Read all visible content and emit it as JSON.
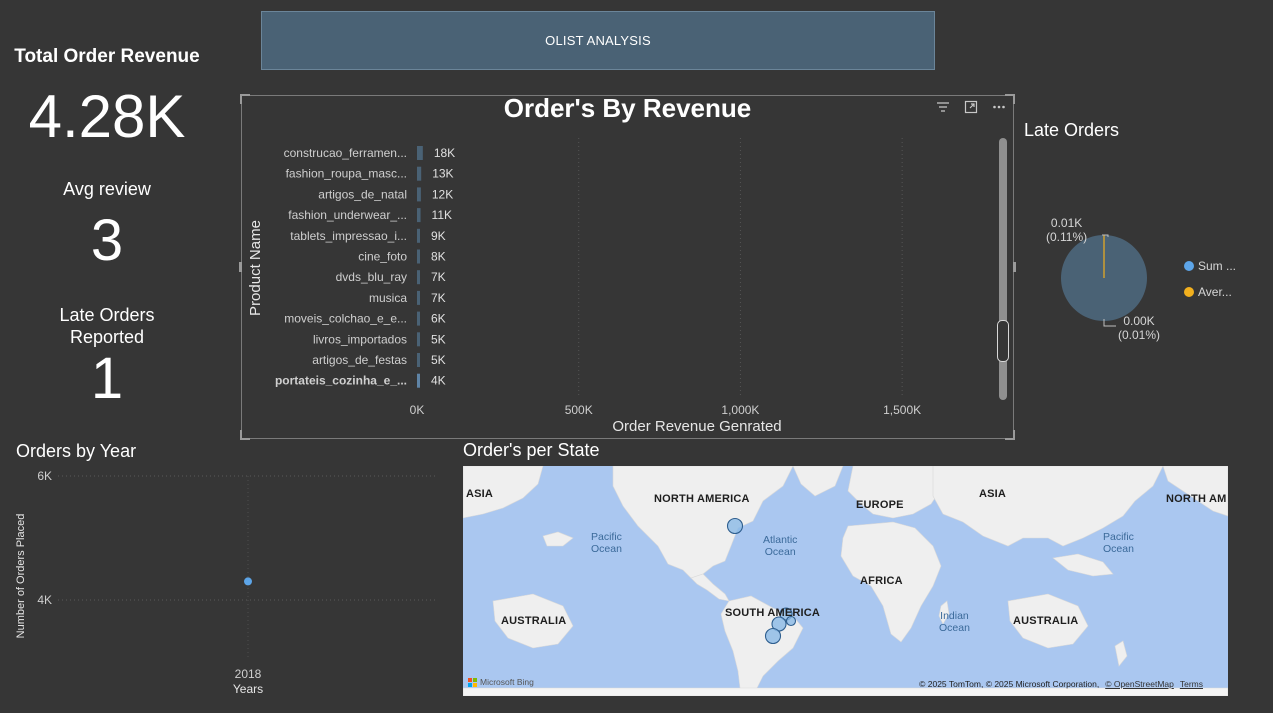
{
  "banner": {
    "title": "OLIST ANALYSIS"
  },
  "kpis": {
    "revenue_label": "Total Order Revenue",
    "revenue_value": "4.28K",
    "review_label": "Avg review",
    "review_value": "3",
    "late_label_line1": "Late Orders",
    "late_label_line2": "Reported",
    "late_value": "1"
  },
  "bar_chart": {
    "title": "Order's By Revenue",
    "icons": [
      "filter-icon",
      "focus-mode-icon",
      "more-options-icon"
    ]
  },
  "pie": {
    "title": "Late Orders",
    "label_top": "0.01K",
    "label_top_pct": "(0.11%)",
    "label_bottom": "0.00K",
    "label_bottom_pct": "(0.01%)",
    "legend": [
      {
        "label": "Sum ...",
        "color": "#5da5e8"
      },
      {
        "label": "Aver...",
        "color": "#f2b01e"
      }
    ]
  },
  "year_chart": {
    "title": "Orders by Year"
  },
  "map": {
    "title": "Order's per State",
    "labels": {
      "asia_left": "ASIA",
      "north_america": "NORTH AMERICA",
      "europe": "EUROPE",
      "asia_right": "ASIA",
      "north_america_right": "NORTH AM",
      "africa": "AFRICA",
      "south_america": "SOUTH AMERICA",
      "australia_left": "AUSTRALIA",
      "australia_right": "AUSTRALIA",
      "pacific_left": "Pacific\nOcean",
      "atlantic": "Atlantic\nOcean",
      "pacific_right": "Pacific\nOcean",
      "indian": "Indian\nOcean"
    },
    "credit": "© 2025 TomTom, © 2025 Microsoft Corporation,",
    "credit_osm": "© OpenStreetMap",
    "credit_terms": "Terms",
    "bing": "Microsoft Bing"
  },
  "chart_data": [
    {
      "type": "bar",
      "orientation": "horizontal",
      "title": "Order's By Revenue",
      "xlabel": "Order Revenue Genrated",
      "ylabel": "Product Name",
      "categories": [
        "construcao_ferramen...",
        "fashion_roupa_masc...",
        "artigos_de_natal",
        "fashion_underwear_...",
        "tablets_impressao_i...",
        "cine_foto",
        "dvds_blu_ray",
        "musica",
        "moveis_colchao_e_e...",
        "livros_importados",
        "artigos_de_festas",
        "portateis_cozinha_e_..."
      ],
      "values": [
        18000,
        13000,
        12000,
        11000,
        9000,
        8000,
        7000,
        7000,
        6000,
        5000,
        5000,
        4000
      ],
      "data_labels": [
        "18K",
        "13K",
        "12K",
        "11K",
        "9K",
        "8K",
        "7K",
        "7K",
        "6K",
        "5K",
        "5K",
        "4K"
      ],
      "xticks": [
        "0K",
        "500K",
        "1,000K",
        "1,500K"
      ],
      "xlim": [
        0,
        1750000
      ],
      "grid": true,
      "color": "#4a6275"
    },
    {
      "type": "pie",
      "title": "Late Orders",
      "series": [
        {
          "name": "Sum ...",
          "value": 0.9989,
          "color": "#4a6275"
        },
        {
          "name": "Aver...",
          "value": 0.0011,
          "color": "#f2b01e"
        }
      ]
    },
    {
      "type": "scatter",
      "title": "Orders by Year",
      "xlabel": "Years",
      "ylabel": "Number of Orders Placed",
      "x": [
        "2018"
      ],
      "y": [
        4300
      ],
      "yticks": [
        "6K",
        "4K"
      ],
      "ylim": [
        3000,
        6000
      ],
      "grid": true,
      "color": "#5da5e8"
    }
  ]
}
